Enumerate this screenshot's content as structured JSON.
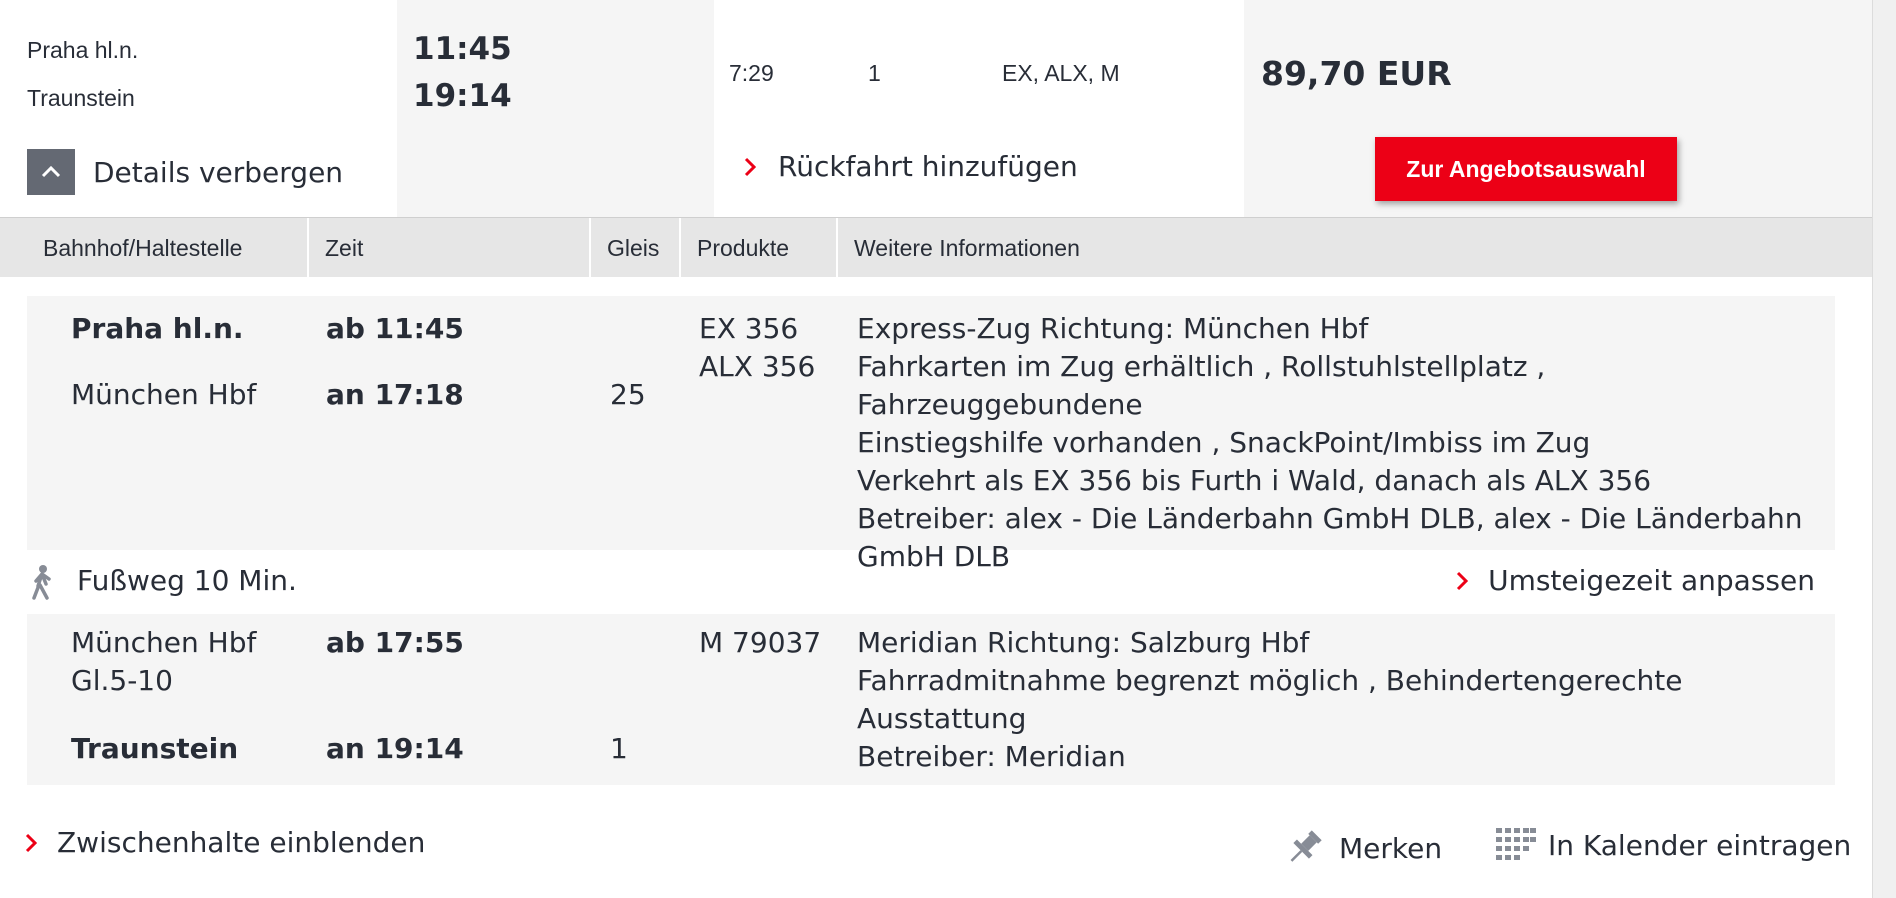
{
  "summary": {
    "from_station": "Praha hl.n.",
    "to_station": "Traunstein",
    "departure_time": "11:45",
    "arrival_time": "19:14",
    "duration": "7:29",
    "changes": "1",
    "products": "EX, ALX, M",
    "price": "89,70 EUR",
    "details_toggle_label": "Details verbergen",
    "return_trip_label": "Rückfahrt hinzufügen",
    "offer_button_label": "Zur Angebotsauswahl"
  },
  "table_headers": [
    "Bahnhof/Haltestelle",
    "Zeit",
    "Gleis",
    "Produkte",
    "Weitere Informationen"
  ],
  "legs": [
    {
      "dep_station": "Praha hl.n.",
      "dep_time": "ab 11:45",
      "arr_station": "München Hbf",
      "arr_time": "an 17:18",
      "arr_platform": "25",
      "product_1": "EX 356",
      "product_2": "ALX 356",
      "info_lines": [
        "Express-Zug Richtung: München Hbf",
        "Fahrkarten im Zug erhältlich , Rollstuhlstellplatz , Fahrzeuggebundene",
        "Einstiegshilfe vorhanden , SnackPoint/Imbiss im Zug",
        "Verkehrt als EX 356 bis Furth i Wald, danach als ALX 356",
        "Betreiber: alex - Die Länderbahn GmbH DLB, alex - Die Länderbahn",
        "GmbH DLB"
      ]
    },
    {
      "dep_station": "München Hbf",
      "dep_station_2": "Gl.5-10",
      "dep_time": "ab 17:55",
      "arr_station": "Traunstein",
      "arr_time": "an 19:14",
      "arr_platform": "1",
      "product_1": "M 79037",
      "info_lines": [
        "Meridian Richtung: Salzburg Hbf",
        "Fahrradmitnahme begrenzt möglich , Behindertengerechte Ausstattung",
        "Betreiber: Meridian"
      ]
    }
  ],
  "transfer": {
    "walk_label": "Fußweg 10 Min.",
    "adjust_label": "Umsteigezeit anpassen"
  },
  "footer": {
    "intermediate_stops_label": "Zwischenhalte einblenden",
    "save_label": "Merken",
    "calendar_label": "In Kalender eintragen"
  },
  "colors": {
    "accent_red": "#ec0016",
    "text": "#282d37",
    "panel_grey": "#f5f5f5",
    "header_grey": "#e6e6e6"
  }
}
